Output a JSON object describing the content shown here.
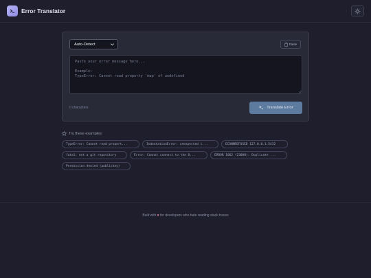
{
  "app": {
    "title": "Error Translator",
    "logo_icon": "terminal-icon",
    "theme_icon": "sun-icon"
  },
  "colors": {
    "accent": "#a8a6f0",
    "button": "#5c7b9e",
    "background": "#1e1e2c"
  },
  "translator": {
    "language_selected": "Auto-Detect",
    "paste_label": "Paste",
    "placeholder": "Paste your error message here...\n\nExample:\nTypeError: Cannot read property 'map' of undefined",
    "char_count": "0 characters",
    "translate_label": "Translate Error"
  },
  "examples": {
    "heading": "Try these examples:",
    "items": [
      "TypeError: Cannot read propert...",
      "IndentationError: unexpected i...",
      "ECONNREFUSED 127.0.0.1:5432",
      "fatal: not a git repository",
      "Error: Cannot connect to the D...",
      "ERROR 1062 (23000): Duplicate ...",
      "Permission denied (publickey)"
    ]
  },
  "footer": {
    "prefix": "Built with",
    "suffix": "for developers who hate reading stack traces"
  }
}
